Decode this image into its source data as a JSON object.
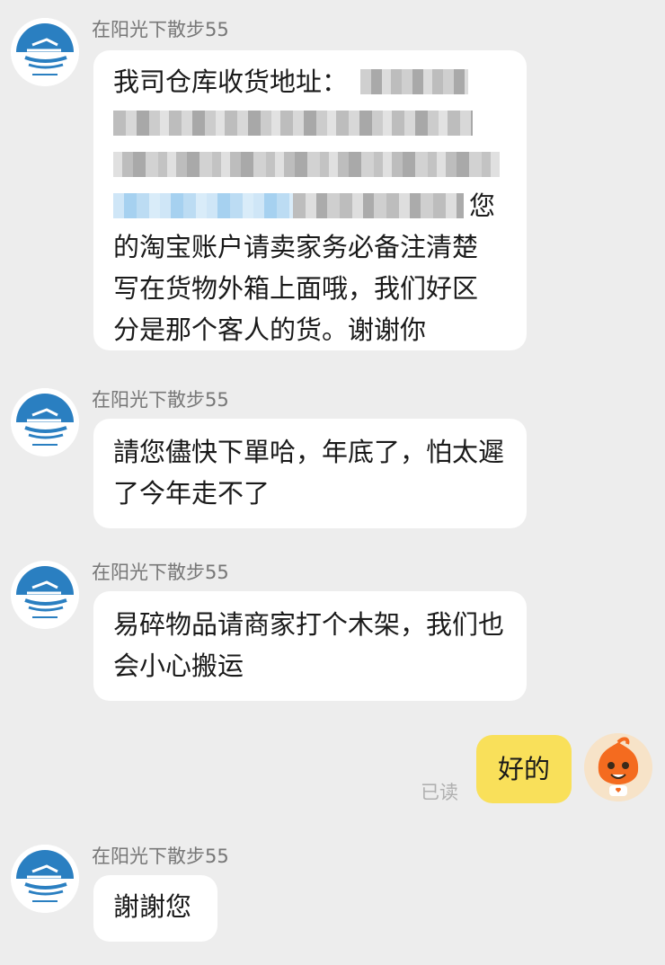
{
  "colors": {
    "background": "#ededed",
    "bubble_incoming": "#ffffff",
    "bubble_outgoing": "#f9e05a",
    "sender_name": "#777777",
    "read_receipt": "#b0b0b0",
    "brand_blue": "#2a7fc1"
  },
  "messages": [
    {
      "sender": "在阳光下散步55",
      "avatar_icon": "ship-logo-icon",
      "text_tail": "您",
      "text_lines": [
        "的淘宝账户请卖家务必备注清楚",
        "写在货物外箱上面哦，我们好区",
        "分是那个客人的货。谢谢你"
      ],
      "address_label": "我司仓库收货地址："
    },
    {
      "sender": "在阳光下散步55",
      "avatar_icon": "ship-logo-icon",
      "text": "請您儘快下單哈，年底了，怕太遲了今年走不了"
    },
    {
      "sender": "在阳光下散步55",
      "avatar_icon": "ship-logo-icon",
      "text": "易碎物品请商家打个木架，我们也会小心搬运"
    },
    {
      "outgoing": true,
      "text": "好的",
      "read_receipt": "已读",
      "avatar_icon": "mascot-icon"
    },
    {
      "sender": "在阳光下散步55",
      "avatar_icon": "ship-logo-icon",
      "text": "謝謝您"
    }
  ]
}
